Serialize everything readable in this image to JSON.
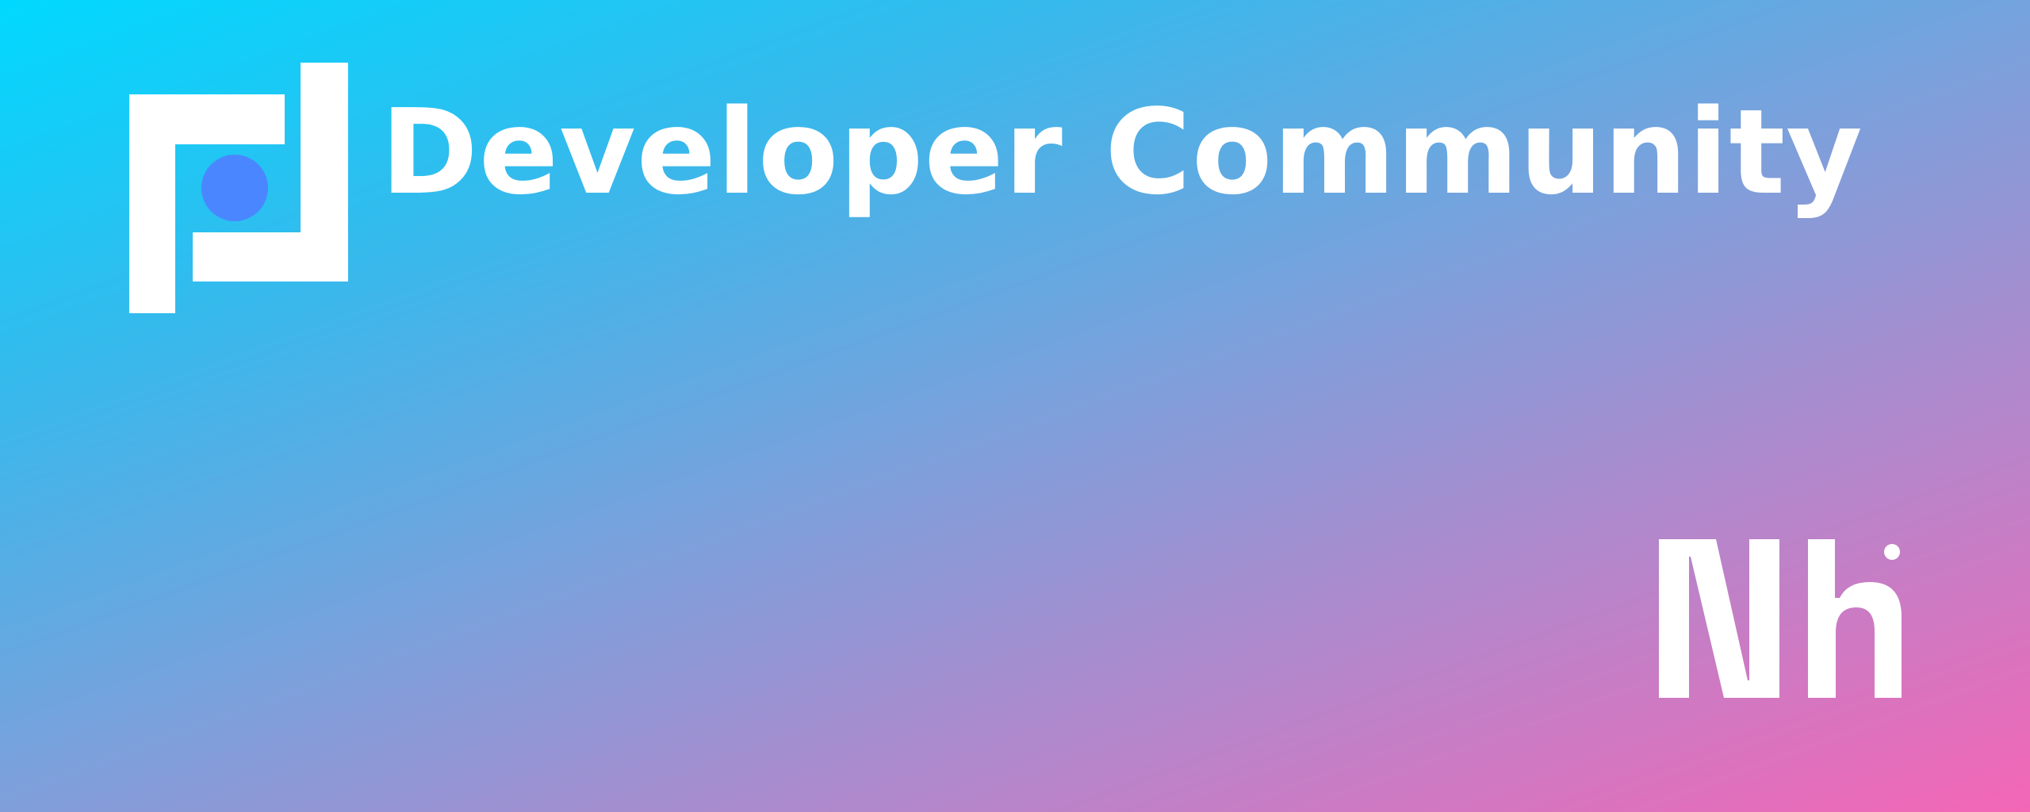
{
  "banner": {
    "title": "Developer Community",
    "logo_icon": "community-logo-icon",
    "corner_icon": "nh-monogram-icon"
  },
  "colors": {
    "gradient_start": "#00d9ff",
    "gradient_end": "#f466b6",
    "text": "#ffffff",
    "logo_dot": "#4a86ff"
  }
}
